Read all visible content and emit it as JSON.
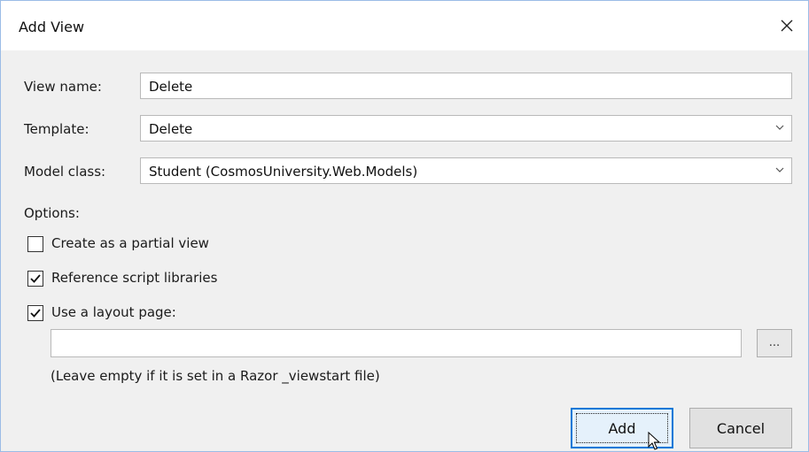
{
  "window": {
    "title": "Add View"
  },
  "form": {
    "view_name_label": "View name:",
    "view_name_value": "Delete",
    "template_label": "Template:",
    "template_value": "Delete",
    "model_class_label": "Model class:",
    "model_class_value": "Student (CosmosUniversity.Web.Models)"
  },
  "options": {
    "heading": "Options:",
    "partial_view_label": "Create as a partial view",
    "partial_view_checked": false,
    "script_libraries_label": "Reference script libraries",
    "script_libraries_checked": true,
    "layout_page_label": "Use a layout page:",
    "layout_page_checked": true,
    "layout_path_value": "",
    "browse_label": "...",
    "hint": "(Leave empty if it is set in a Razor _viewstart file)"
  },
  "buttons": {
    "add_label": "Add",
    "cancel_label": "Cancel"
  },
  "icons": {
    "close": "close-icon",
    "dropdown": "chevron-down-icon",
    "check": "checkmark-icon",
    "cursor": "mouse-pointer-icon"
  },
  "colors": {
    "accent": "#0078d7",
    "window_border": "#9bbce6",
    "button_focus_bg": "#e5f1fb"
  }
}
